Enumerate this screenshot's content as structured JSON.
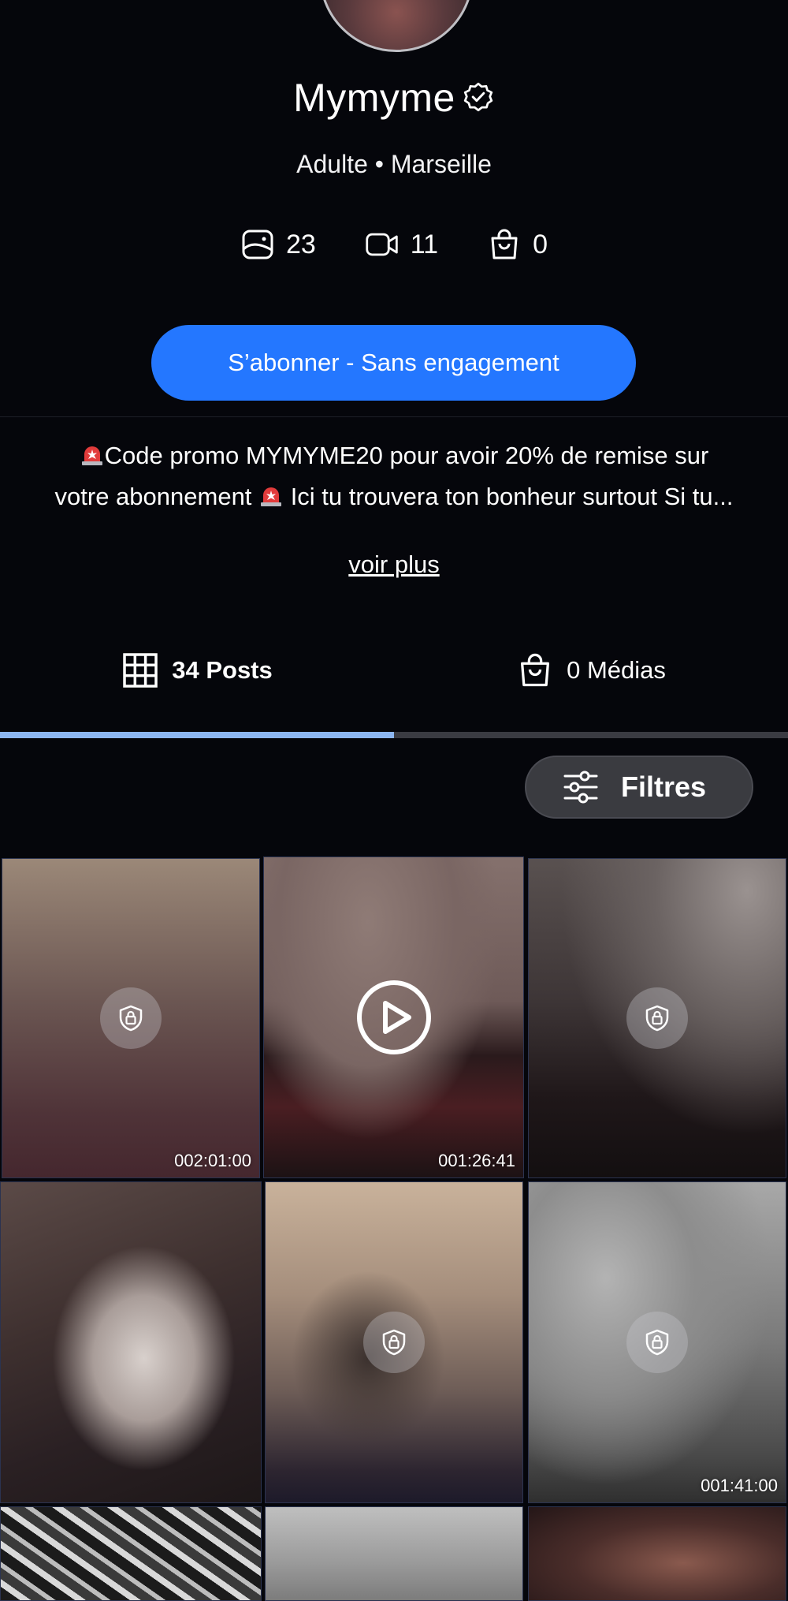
{
  "profile": {
    "username": "Mymyme",
    "subtitle": "Adulte • Marseille",
    "stats": {
      "photos": "23",
      "videos": "11",
      "shop": "0"
    }
  },
  "subscribe_label": "S’abonner - Sans engagement",
  "bio": {
    "line1": "Code promo MYMYME20 pour avoir 20% de remise sur",
    "line2_a": "votre abonnement",
    "line2_b": "Ici tu trouvera ton bonheur surtout Si tu...",
    "more_label": "voir plus"
  },
  "tabs": {
    "posts_label": "34 Posts",
    "media_label": "0 Médias"
  },
  "filters_label": "Filtres",
  "grid": {
    "durations": [
      "002:01:00",
      "001:26:41",
      "001:41:00"
    ]
  },
  "colors": {
    "accent": "#2477ff",
    "tab_indicator": "#8cb6f2",
    "background": "#05060b"
  }
}
